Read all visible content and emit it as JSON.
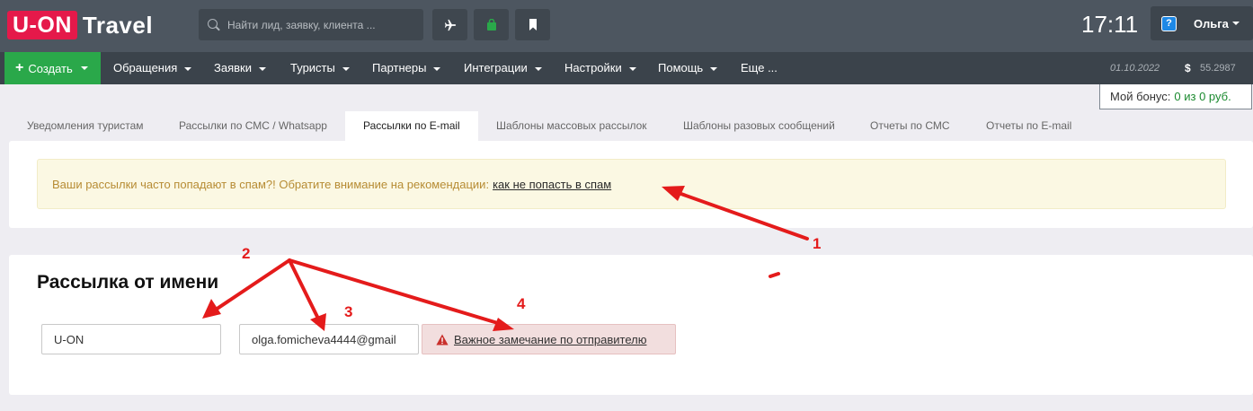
{
  "header": {
    "logo_box": "U-ON",
    "logo_text": "Travel",
    "search_placeholder": "Найти лид, заявку, клиента ...",
    "clock": "17:11",
    "user_name": "Ольга",
    "help_glyph": "?"
  },
  "nav": {
    "create_label": "Создать",
    "items": [
      "Обращения",
      "Заявки",
      "Туристы",
      "Партнеры",
      "Интеграции",
      "Настройки",
      "Помощь",
      "Еще ..."
    ],
    "date": "01.10.2022",
    "currency": "$",
    "balance": "55.2987"
  },
  "bonus": {
    "label": "Мой бонус:",
    "value": "0 из 0 руб."
  },
  "tabs": [
    {
      "label": "Уведомления туристам",
      "active": false
    },
    {
      "label": "Рассылки по СМС / Whatsapp",
      "active": false
    },
    {
      "label": "Рассылки по E-mail",
      "active": true
    },
    {
      "label": "Шаблоны массовых рассылок",
      "active": false
    },
    {
      "label": "Шаблоны разовых сообщений",
      "active": false
    },
    {
      "label": "Отчеты по СМС",
      "active": false
    },
    {
      "label": "Отчеты по E-mail",
      "active": false
    }
  ],
  "alert": {
    "text": "Ваши рассылки часто попадают в спам?! Обратите внимание на рекомендации:",
    "link": "как не попасть в спам"
  },
  "sender": {
    "title": "Рассылка от имени",
    "name_value": "U-ON",
    "email_value": "olga.fomicheva4444@gmail",
    "warning_label": "Важное замечание по отправителю"
  },
  "annotations": [
    "1",
    "2",
    "3",
    "4"
  ],
  "colors": {
    "topbar": "#4d5660",
    "navbar": "#3b434b",
    "brand_red": "#e5194a",
    "create_green": "#2aa84a",
    "annotation_red": "#e41b1b"
  },
  "icons": {
    "search": "search-icon",
    "plane": "plane-icon",
    "bag": "bag-icon",
    "bookmark": "bookmark-icon",
    "help": "help-icon",
    "warning": "warning-icon"
  }
}
